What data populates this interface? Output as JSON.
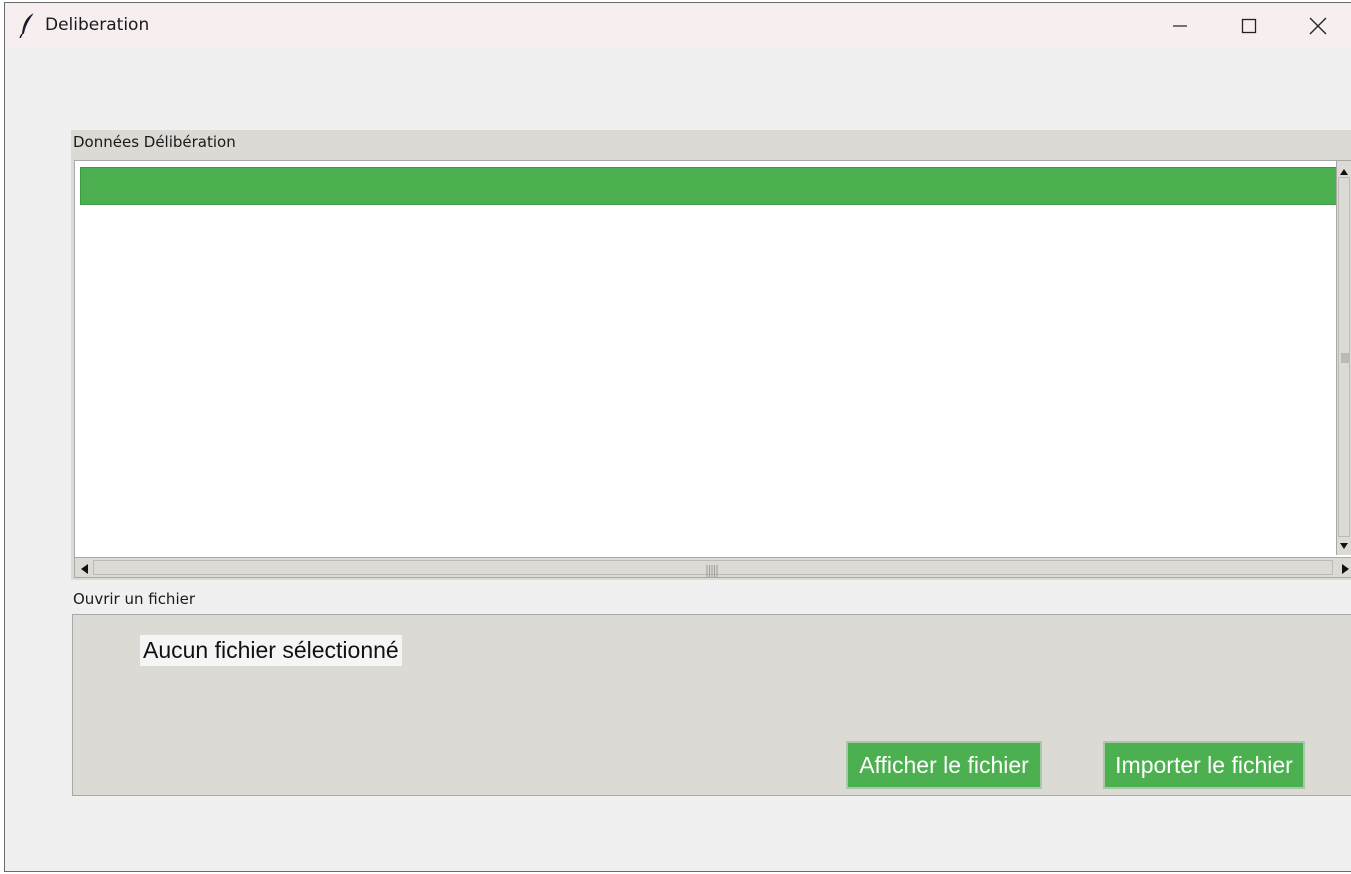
{
  "window": {
    "title": "Deliberation"
  },
  "data_section": {
    "label": "Données Délibération",
    "header_text": "",
    "accent_color": "#4caf50"
  },
  "file_section": {
    "label": "Ouvrir un fichier",
    "status_text": "Aucun fichier sélectionné",
    "show_button_label": "Afficher le fichier",
    "import_button_label": "Importer le fichier"
  },
  "icons": {
    "app": "feather-icon",
    "minimize": "minimize-icon",
    "maximize": "maximize-icon",
    "close": "close-icon"
  }
}
